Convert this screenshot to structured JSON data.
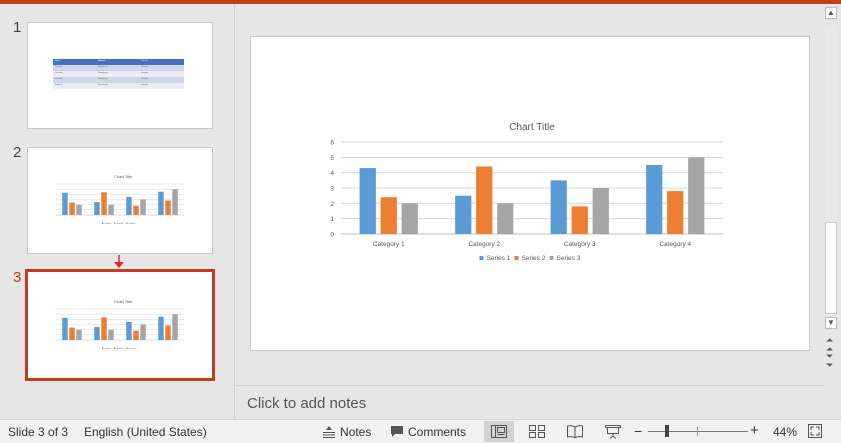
{
  "thumbnails": [
    {
      "number": "1",
      "table": {
        "headers": [
          "Name",
          "Address",
          "Contact"
        ],
        "rows": [
          [
            "Location",
            "Something",
            "Number"
          ],
          [
            "Location",
            "Something",
            "Number"
          ],
          [
            "Location",
            "Something",
            "Number"
          ],
          [
            "Address",
            "Something",
            "Number"
          ]
        ]
      }
    },
    {
      "number": "2",
      "chart_title": "Chart Title"
    },
    {
      "number": "3",
      "chart_title": "Chart Title"
    }
  ],
  "chart_data": {
    "type": "bar",
    "title": "Chart Title",
    "categories": [
      "Category 1",
      "Category 2",
      "Category 3",
      "Category 4"
    ],
    "series": [
      {
        "name": "Series 1",
        "values": [
          4.3,
          2.5,
          3.5,
          4.5
        ],
        "color": "#5b9bd5"
      },
      {
        "name": "Series 2",
        "values": [
          2.4,
          4.4,
          1.8,
          2.8
        ],
        "color": "#ed7d31"
      },
      {
        "name": "Series 3",
        "values": [
          2,
          2,
          3,
          5
        ],
        "color": "#a5a5a5"
      }
    ],
    "yticks": [
      "0",
      "1",
      "2",
      "3",
      "4",
      "5",
      "6"
    ],
    "ylim": [
      0,
      6
    ],
    "grid": true,
    "legend_position": "bottom"
  },
  "notes": {
    "placeholder": "Click to add notes"
  },
  "status": {
    "slide_info": "Slide 3 of 3",
    "language": "English (United States)",
    "notes_label": "Notes",
    "comments_label": "Comments",
    "zoom_minus": "−",
    "zoom_plus": "+",
    "zoom_percent": "44%"
  },
  "colors": {
    "accent": "#c43e1c",
    "table_header": "#4472c4"
  }
}
